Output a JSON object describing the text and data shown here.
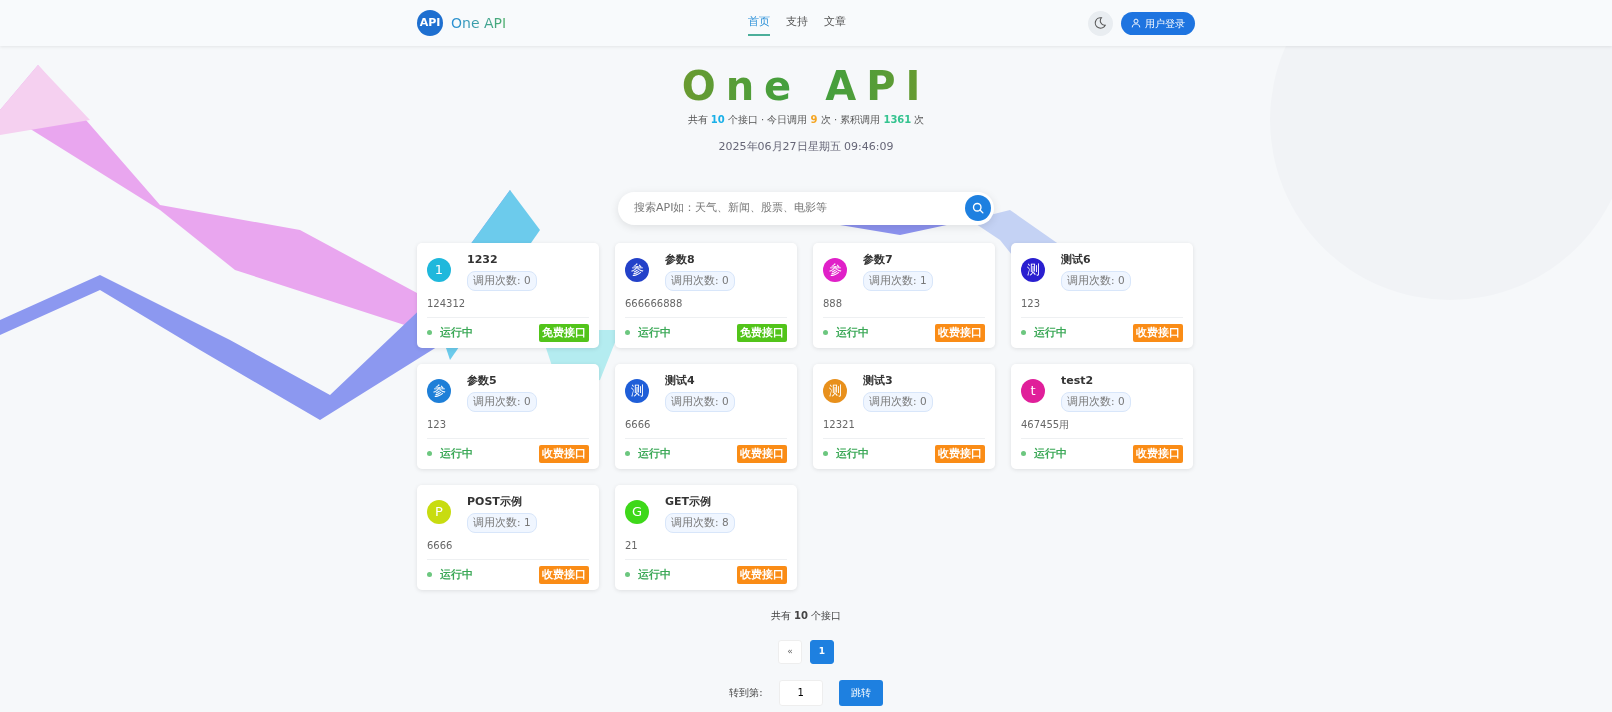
{
  "navbar": {
    "logo_text": "API",
    "brand": "One API",
    "links": [
      {
        "label": "首页",
        "selected": true
      },
      {
        "label": "支持",
        "selected": false
      },
      {
        "label": "文章",
        "selected": false
      }
    ],
    "login_button": "用户登录"
  },
  "hero": {
    "title": "One API",
    "stats": [
      {
        "before": "共有",
        "value": "10",
        "after": "个接口",
        "color": "#1ab0e8"
      },
      {
        "before": "今日调用",
        "value": "9",
        "after": "次",
        "color": "#f5a623"
      },
      {
        "before": "累积调用",
        "value": "1361",
        "after": "次",
        "color": "#34c38f"
      }
    ],
    "separator": "·",
    "datetime": "2025年06月27日星期五 09:46:09"
  },
  "search": {
    "placeholder": "搜索API如：天气、新闻、股票、电影等"
  },
  "apis": [
    {
      "initial": "1",
      "color": "#1fb8dc",
      "name": "1232",
      "calls": "调用次数: 0",
      "description": "124312",
      "status": "运行中",
      "running": true,
      "tag": "免费接口",
      "kind": "free"
    },
    {
      "initial": "参",
      "color": "#2341c9",
      "name": "参数8",
      "calls": "调用次数: 0",
      "description": "666666888",
      "status": "运行中",
      "running": true,
      "tag": "免费接口",
      "kind": "free"
    },
    {
      "initial": "参",
      "color": "#e020c8",
      "name": "参数7",
      "calls": "调用次数: 1",
      "description": "888",
      "status": "运行中",
      "running": true,
      "tag": "收费接口",
      "kind": "paid"
    },
    {
      "initial": "测",
      "color": "#2a1fd0",
      "name": "测试6",
      "calls": "调用次数: 0",
      "description": "123",
      "status": "运行中",
      "running": true,
      "tag": "收费接口",
      "kind": "paid"
    },
    {
      "initial": "参",
      "color": "#1e7fd8",
      "name": "参数5",
      "calls": "调用次数: 0",
      "description": "123",
      "status": "运行中",
      "running": true,
      "tag": "收费接口",
      "kind": "paid"
    },
    {
      "initial": "测",
      "color": "#1f5ed8",
      "name": "测试4",
      "calls": "调用次数: 0",
      "description": "6666",
      "status": "运行中",
      "running": true,
      "tag": "收费接口",
      "kind": "paid"
    },
    {
      "initial": "测",
      "color": "#e8901c",
      "name": "测试3",
      "calls": "调用次数: 0",
      "description": "12321",
      "status": "运行中",
      "running": true,
      "tag": "收费接口",
      "kind": "paid"
    },
    {
      "initial": "t",
      "color": "#e01f9a",
      "name": "test2",
      "calls": "调用次数: 0",
      "description": "467455用",
      "status": "运行中",
      "running": true,
      "tag": "收费接口",
      "kind": "paid"
    },
    {
      "initial": "P",
      "color": "#c8dc10",
      "name": "POST示例",
      "calls": "调用次数: 1",
      "description": "6666",
      "status": "运行中",
      "running": true,
      "tag": "收费接口",
      "kind": "paid"
    },
    {
      "initial": "G",
      "color": "#3ed81a",
      "name": "GET示例",
      "calls": "调用次数: 8",
      "description": "21",
      "status": "运行中",
      "running": true,
      "tag": "收费接口",
      "kind": "paid"
    }
  ],
  "pagination": {
    "total": "共有 **10** 个接口",
    "prev": "«",
    "pages": [
      {
        "label": "1",
        "selected": true
      }
    ],
    "jump_label": "转到第:",
    "jump_value": "1",
    "jump_button": "跳转"
  }
}
